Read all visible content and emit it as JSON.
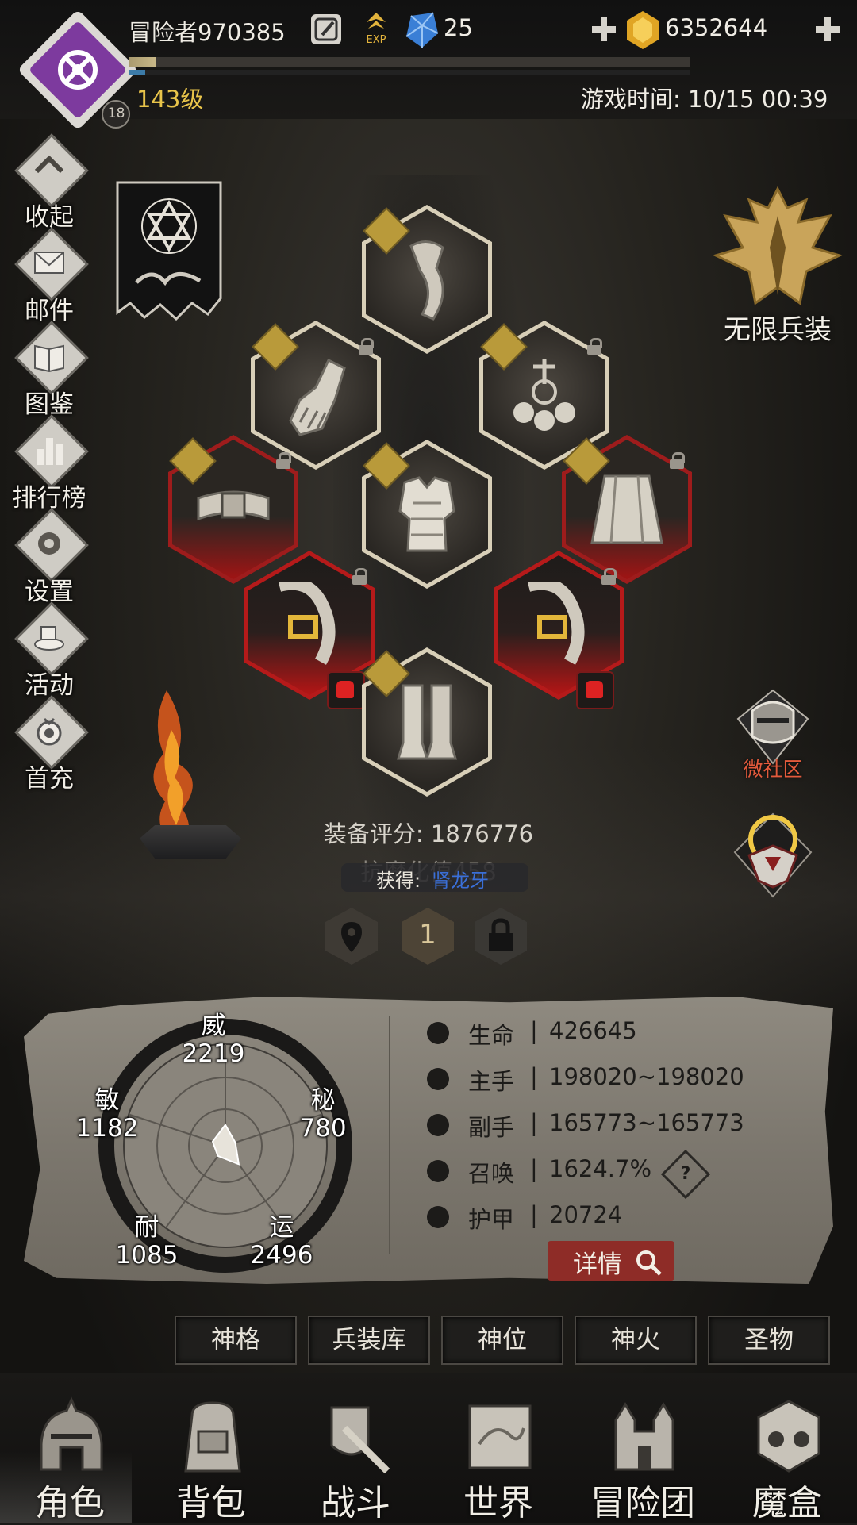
{
  "header": {
    "player_name": "冒险者970385",
    "exp_icon_text": "EXP",
    "gems": "25",
    "gold": "6352644",
    "level": "143级",
    "avatar_badge": "18",
    "game_time": "游戏时间: 10/15 00:39",
    "exp_progress": 0.05,
    "secondary_progress": 0.03
  },
  "side_menu": [
    {
      "label": "收起",
      "icon": "collapse-icon"
    },
    {
      "label": "邮件",
      "icon": "mail-icon"
    },
    {
      "label": "图鉴",
      "icon": "book-icon"
    },
    {
      "label": "排行榜",
      "icon": "ranking-icon"
    },
    {
      "label": "设置",
      "icon": "gear-icon"
    },
    {
      "label": "活动",
      "icon": "event-icon"
    },
    {
      "label": "首充",
      "icon": "first-recharge-icon"
    }
  ],
  "right_menu": {
    "infinite_equip": "无限兵装",
    "community": "微社区"
  },
  "equipment": {
    "score": "装备评分: 1876776",
    "resist": "抗魔化值458",
    "obtain_label": "获得:",
    "obtain_value": "肾龙牙",
    "page": "1"
  },
  "attributes": {
    "wei": {
      "label": "威",
      "value": "2219"
    },
    "min": {
      "label": "敏",
      "value": "1182"
    },
    "mi": {
      "label": "秘",
      "value": "780"
    },
    "nai": {
      "label": "耐",
      "value": "1085"
    },
    "yun": {
      "label": "运",
      "value": "2496"
    }
  },
  "stats": [
    {
      "label": "生命",
      "value": "426645",
      "icon": "heart-icon"
    },
    {
      "label": "主手",
      "value": "198020~198020",
      "icon": "main-hand-icon"
    },
    {
      "label": "副手",
      "value": "165773~165773",
      "icon": "off-hand-icon"
    },
    {
      "label": "召唤",
      "value": "1624.7%",
      "icon": "summon-icon"
    },
    {
      "label": "护甲",
      "value": "20724",
      "icon": "armor-icon"
    }
  ],
  "stats_separator": "|",
  "help_symbol": "?",
  "details_label": "详情",
  "tabs": [
    "神格",
    "兵装库",
    "神位",
    "神火",
    "圣物"
  ],
  "bottom_nav": [
    "角色",
    "背包",
    "战斗",
    "世界",
    "冒险团",
    "魔盒"
  ],
  "colors": {
    "avatar_purple": "#7d3a9e",
    "level_gold": "#e8c44a",
    "slot_red": "#b51a1a",
    "details_red": "#8e2c27",
    "community_red": "#e25a3c",
    "obtain_blue": "#3a6fd8"
  }
}
